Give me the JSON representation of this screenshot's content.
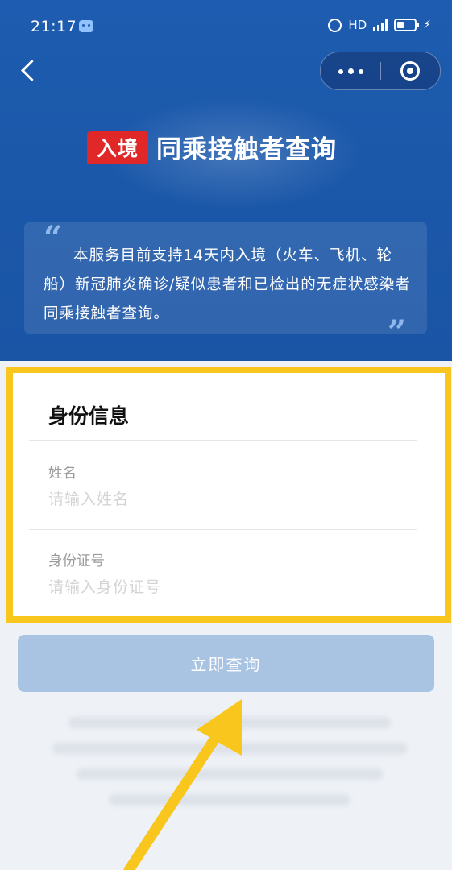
{
  "status_bar": {
    "time": "21:17",
    "network": "HD",
    "icons": [
      "app-icon",
      "alarm-icon",
      "signal-icon",
      "battery-icon",
      "charging-bolt-icon"
    ]
  },
  "nav": {
    "back_icon": "chevron-left-icon",
    "more_icon": "more-dots-icon",
    "close_icon": "target-close-icon"
  },
  "banner": {
    "tag": "入境",
    "title": "同乘接触者查询",
    "tag_color": "#e02828"
  },
  "notice": {
    "quote_open": "“",
    "quote_close": "”",
    "text": "本服务目前支持14天内入境（火车、飞机、轮船）新冠肺炎确诊/疑似患者和已检出的无症状感染者同乘接触者查询。"
  },
  "form": {
    "section_title": "身份信息",
    "name": {
      "label": "姓名",
      "value": "",
      "placeholder": "请输入姓名"
    },
    "id_number": {
      "label": "身份证号",
      "value": "",
      "placeholder": "请输入身份证号"
    }
  },
  "actions": {
    "submit_label": "立即查询",
    "button_color": "#a9c4e2"
  },
  "theme": {
    "header_blue": "#1d5cb0",
    "highlight_yellow": "#f8c61c",
    "page_background": "#eef2f7"
  }
}
